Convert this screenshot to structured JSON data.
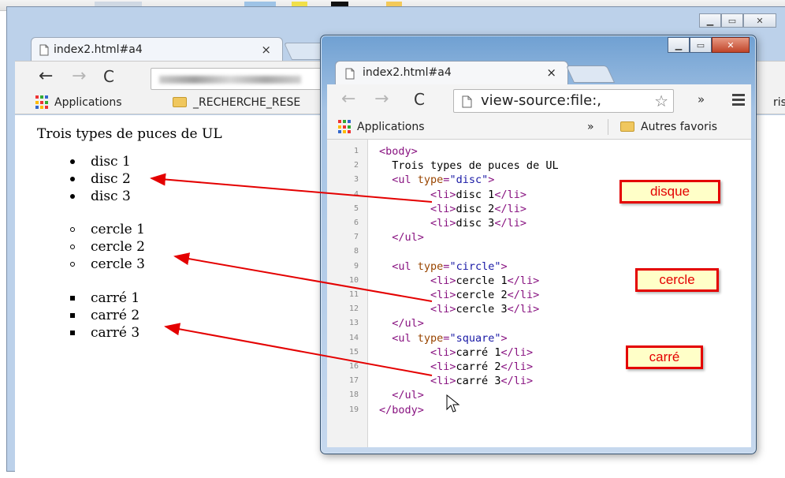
{
  "back_window": {
    "tab_title": "index2.html#a4",
    "tab_close": "×",
    "bookmarks": {
      "apps": "Applications",
      "folder": "_RECHERCHE_RESE",
      "cut_text": "ris"
    },
    "page": {
      "heading": "Trois types de puces de UL",
      "disc_items": [
        "disc 1",
        "disc 2",
        "disc 3"
      ],
      "circle_items": [
        "cercle 1",
        "cercle 2",
        "cercle 3"
      ],
      "square_items": [
        "carré 1",
        "carré 2",
        "carré 3"
      ]
    }
  },
  "front_window": {
    "tab_title": "index2.html#a4",
    "tab_close": "×",
    "address": "view-source:file:,",
    "overflow_chevron": "»",
    "bookmarks": {
      "apps": "Applications",
      "more": "»",
      "others": "Autres favoris"
    },
    "source_lines": [
      {
        "n": "1",
        "parts": [
          [
            "tag",
            "<body>"
          ]
        ]
      },
      {
        "n": "2",
        "parts": [
          [
            "plain",
            "  Trois types de puces de UL"
          ]
        ]
      },
      {
        "n": "3",
        "parts": [
          [
            "tag",
            "  <ul "
          ],
          [
            "attr",
            "type"
          ],
          [
            "tag",
            "="
          ],
          [
            "val",
            "\"disc\""
          ],
          [
            "tag",
            ">"
          ]
        ]
      },
      {
        "n": "4",
        "parts": [
          [
            "tag",
            "        <li>"
          ],
          [
            "plain",
            "disc 1"
          ],
          [
            "tag",
            "</li>"
          ]
        ]
      },
      {
        "n": "5",
        "parts": [
          [
            "tag",
            "        <li>"
          ],
          [
            "plain",
            "disc 2"
          ],
          [
            "tag",
            "</li>"
          ]
        ]
      },
      {
        "n": "6",
        "parts": [
          [
            "tag",
            "        <li>"
          ],
          [
            "plain",
            "disc 3"
          ],
          [
            "tag",
            "</li>"
          ]
        ]
      },
      {
        "n": "7",
        "parts": [
          [
            "tag",
            "  </ul>"
          ]
        ]
      },
      {
        "n": "8",
        "parts": [
          [
            "plain",
            ""
          ]
        ]
      },
      {
        "n": "9",
        "parts": [
          [
            "tag",
            "  <ul "
          ],
          [
            "attr",
            "type"
          ],
          [
            "tag",
            "="
          ],
          [
            "val",
            "\"circle\""
          ],
          [
            "tag",
            ">"
          ]
        ]
      },
      {
        "n": "10",
        "parts": [
          [
            "tag",
            "        <li>"
          ],
          [
            "plain",
            "cercle 1"
          ],
          [
            "tag",
            "</li>"
          ]
        ]
      },
      {
        "n": "11",
        "parts": [
          [
            "tag",
            "        <li>"
          ],
          [
            "plain",
            "cercle 2"
          ],
          [
            "tag",
            "</li>"
          ]
        ]
      },
      {
        "n": "12",
        "parts": [
          [
            "tag",
            "        <li>"
          ],
          [
            "plain",
            "cercle 3"
          ],
          [
            "tag",
            "</li>"
          ]
        ]
      },
      {
        "n": "13",
        "parts": [
          [
            "tag",
            "  </ul>"
          ]
        ]
      },
      {
        "n": "14",
        "parts": [
          [
            "tag",
            "  <ul "
          ],
          [
            "attr",
            "type"
          ],
          [
            "tag",
            "="
          ],
          [
            "val",
            "\"square\""
          ],
          [
            "tag",
            ">"
          ]
        ]
      },
      {
        "n": "15",
        "parts": [
          [
            "tag",
            "        <li>"
          ],
          [
            "plain",
            "carré 1"
          ],
          [
            "tag",
            "</li>"
          ]
        ]
      },
      {
        "n": "16",
        "parts": [
          [
            "tag",
            "        <li>"
          ],
          [
            "plain",
            "carré 2"
          ],
          [
            "tag",
            "</li>"
          ]
        ]
      },
      {
        "n": "17",
        "parts": [
          [
            "tag",
            "        <li>"
          ],
          [
            "plain",
            "carré 3"
          ],
          [
            "tag",
            "</li>"
          ]
        ]
      },
      {
        "n": "18",
        "parts": [
          [
            "tag",
            "  </ul>"
          ]
        ]
      },
      {
        "n": "19",
        "parts": [
          [
            "tag",
            "</body>"
          ]
        ]
      }
    ]
  },
  "annotations": {
    "disc": "disque",
    "circle": "cercle",
    "square": "carré"
  },
  "colors": {
    "annotation_red": "#e40000",
    "annotation_bg": "#ffffc8",
    "tag": "#881280",
    "attr_name": "#994500",
    "attr_value": "#1a1aa6"
  },
  "icons": [
    "page-icon",
    "close-icon",
    "back-arrow-icon",
    "forward-arrow-icon",
    "reload-icon",
    "star-icon",
    "menu-icon",
    "apps-grid-icon",
    "folder-icon",
    "minimize-icon",
    "maximize-icon",
    "mouse-cursor-icon"
  ]
}
